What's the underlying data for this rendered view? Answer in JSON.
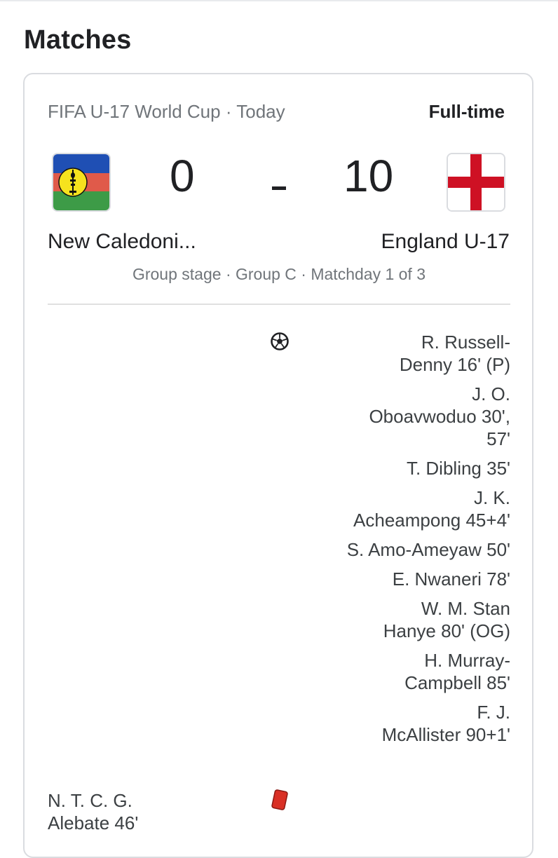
{
  "section_title": "Matches",
  "match": {
    "competition": "FIFA U-17 World Cup",
    "separator": " · ",
    "date": "Today",
    "status": "Full-time",
    "home": {
      "name": "New Caledoni...",
      "score": "0",
      "flag_icon": "new-caledonia-flag-icon"
    },
    "away": {
      "name": "England U-17",
      "score": "10",
      "flag_icon": "england-flag-icon"
    },
    "stage": "Group stage · Group C · Matchday 1 of 3",
    "goals_away": [
      "R. Russell-\nDenny 16' (P)",
      "J. O.\nOboavwoduo 30',\n57'",
      "T. Dibling 35'",
      "J. K.\nAcheampong 45+4'",
      "S. Amo-Ameyaw 50'",
      "E. Nwaneri 78'",
      "W. M. Stan\nHanye 80' (OG)",
      "H. Murray-\nCampbell 85'",
      "F. J.\nMcAllister 90+1'"
    ],
    "red_cards_home": [
      "N. T. C. G.\nAlebate 46'"
    ]
  },
  "colors": {
    "text_primary": "#202124",
    "text_secondary": "#70757a",
    "red_card": "#d93025",
    "nc_blue": "#1f4fb4",
    "nc_red": "#e05a4a",
    "nc_green": "#3d9b47",
    "nc_yellow": "#f6e21e",
    "england_red": "#ce1124"
  },
  "icons": {
    "goal": "soccer-ball-icon",
    "red_card": "red-card-icon"
  }
}
